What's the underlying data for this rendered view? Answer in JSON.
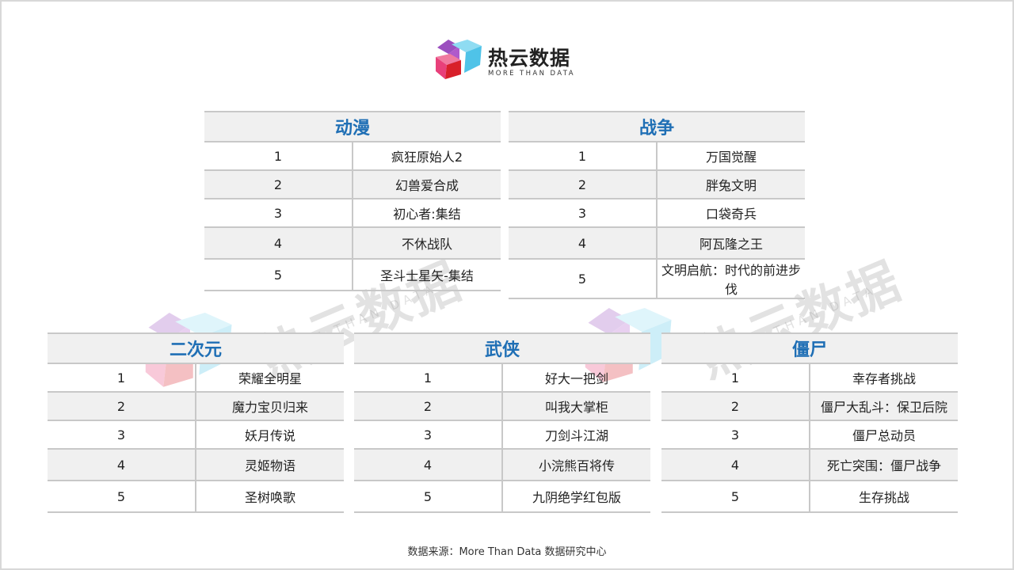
{
  "brand": {
    "name": "热云数据",
    "tagline": "MORE THAN DATA",
    "colors": {
      "cyan": "#4fc3e8",
      "purple": "#9b4fbf",
      "pink": "#e8407a",
      "red": "#d8202a"
    }
  },
  "tables": [
    {
      "title": "动漫",
      "rows": [
        {
          "rank": "1",
          "name": "疯狂原始人2"
        },
        {
          "rank": "2",
          "name": "幻兽爱合成"
        },
        {
          "rank": "3",
          "name": "初心者:集结"
        },
        {
          "rank": "4",
          "name": "不休战队"
        },
        {
          "rank": "5",
          "name": "圣斗士星矢-集结"
        }
      ]
    },
    {
      "title": "战争",
      "rows": [
        {
          "rank": "1",
          "name": "万国觉醒"
        },
        {
          "rank": "2",
          "name": "胖兔文明"
        },
        {
          "rank": "3",
          "name": "口袋奇兵"
        },
        {
          "rank": "4",
          "name": "阿瓦隆之王"
        },
        {
          "rank": "5",
          "name": "文明启航：时代的前进步伐"
        }
      ]
    },
    {
      "title": "二次元",
      "rows": [
        {
          "rank": "1",
          "name": "荣耀全明星"
        },
        {
          "rank": "2",
          "name": "魔力宝贝归来"
        },
        {
          "rank": "3",
          "name": "妖月传说"
        },
        {
          "rank": "4",
          "name": "灵姬物语"
        },
        {
          "rank": "5",
          "name": "圣树唤歌"
        }
      ]
    },
    {
      "title": "武侠",
      "rows": [
        {
          "rank": "1",
          "name": "好大一把剑"
        },
        {
          "rank": "2",
          "name": "叫我大掌柜"
        },
        {
          "rank": "3",
          "name": "刀剑斗江湖"
        },
        {
          "rank": "4",
          "name": "小浣熊百将传"
        },
        {
          "rank": "5",
          "name": "九阴绝学红包版"
        }
      ]
    },
    {
      "title": "僵尸",
      "rows": [
        {
          "rank": "1",
          "name": "幸存者挑战"
        },
        {
          "rank": "2",
          "name": "僵尸大乱斗：保卫后院"
        },
        {
          "rank": "3",
          "name": "僵尸总动员"
        },
        {
          "rank": "4",
          "name": "死亡突围：僵尸战争"
        },
        {
          "rank": "5",
          "name": "生存挑战"
        }
      ]
    }
  ],
  "source": "数据来源：More Than Data 数据研究中心"
}
